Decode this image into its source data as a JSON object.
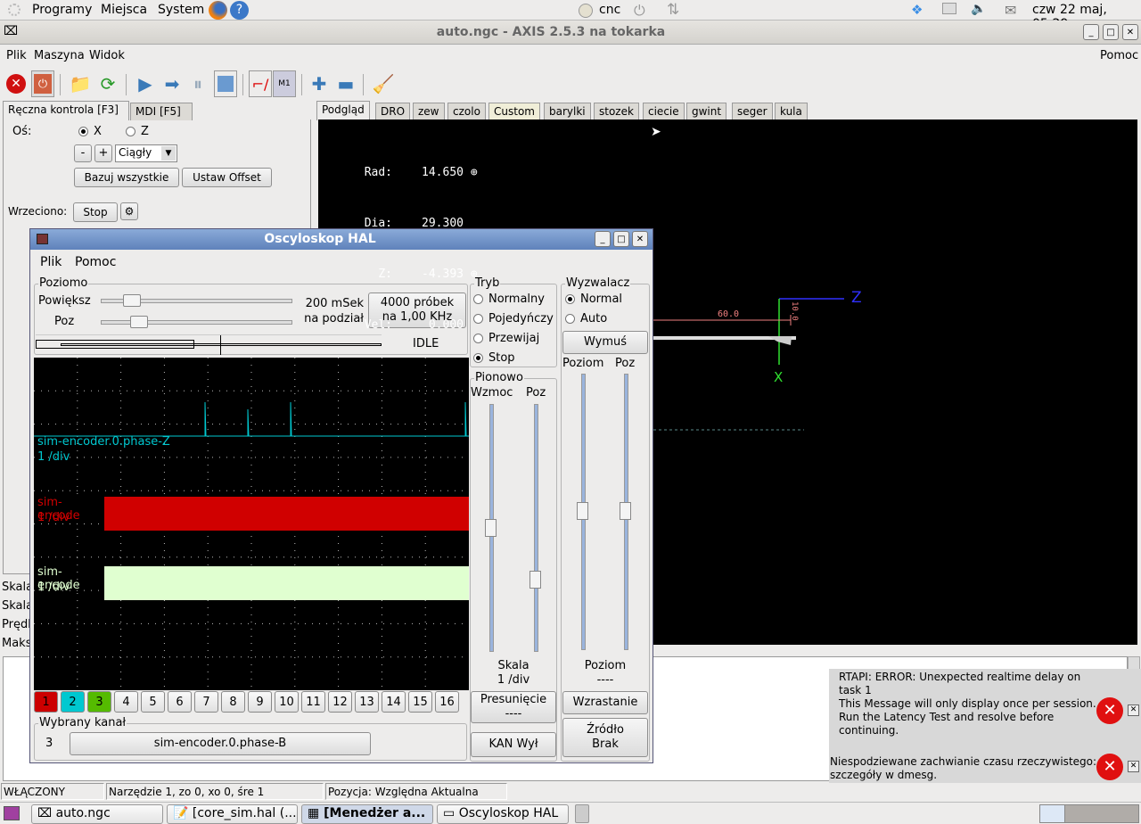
{
  "top_panel": {
    "menus": [
      "Programy",
      "Miejsca",
      "System"
    ],
    "user": "cnc",
    "clock": "czw 22 maj, 05:29"
  },
  "axis": {
    "title": "auto.ngc - AXIS 2.5.3 na tokarka",
    "menu": [
      "Plik",
      "Maszyna",
      "Widok"
    ],
    "help": "Pomoc",
    "left_tabs": [
      "Ręczna kontrola [F3]",
      "MDI [F5]"
    ],
    "manual": {
      "axis_label": "Oś:",
      "axis_x": "X",
      "axis_z": "Z",
      "minus": "-",
      "plus": "+",
      "jog_mode": "Ciągły",
      "home_all": "Bazuj wszystkie",
      "set_offset": "Ustaw Offset",
      "spindle_label": "Wrzeciono:",
      "spindle_stop": "Stop"
    },
    "side_labels": [
      "Skala",
      "Skala",
      "Prędk",
      "Maks"
    ],
    "right_tabs": [
      "Podgląd",
      "DRO",
      "zew",
      "czolo",
      "Custom",
      "barylki",
      "stozek",
      "ciecie",
      "gwint",
      "seger",
      "kula"
    ],
    "dro": [
      {
        "label": "Rad:",
        "value": "14.650"
      },
      {
        "label": "Dia:",
        "value": "29.300"
      },
      {
        "label": "Z:",
        "value": "-4.393"
      },
      {
        "label": "Vel:",
        "value": "0.000"
      }
    ],
    "preview": {
      "dim_z": "60.0",
      "dim_x": "10.0",
      "axis_z": "Z",
      "axis_x": "X"
    },
    "status": {
      "state": "WŁĄCZONY",
      "tool": "Narzędzie 1, zo 0, xo 0, śre 1",
      "position": "Pozycja: Względna Aktualna"
    },
    "notifications": [
      {
        "text": "RTAPI: ERROR: Unexpected realtime delay on task 1\nThis Message will only display once per session.\nRun the Latency Test and resolve before continuing."
      },
      {
        "text": "Niespodziewane zachwianie czasu rzeczywistego: szczegóły w dmesg."
      }
    ]
  },
  "scope": {
    "title": "Oscyloskop HAL",
    "menu": [
      "Plik",
      "Pomoc"
    ],
    "horizontal": {
      "legend": "Poziomo",
      "zoom_label": "Powiększ",
      "pos_label": "Poz",
      "rate": "200 mSek\nna podział",
      "samples": "4000 próbek\nna 1,00 KHz",
      "state": "IDLE"
    },
    "mode": {
      "legend": "Tryb",
      "options": [
        "Normalny",
        "Pojedyńczy",
        "Przewijaj",
        "Stop"
      ],
      "selected": "Stop"
    },
    "trigger": {
      "legend": "Wyzwalacz",
      "options": [
        "Normal",
        "Auto"
      ],
      "selected": "Normal",
      "force": "Wymuś",
      "level_label": "Poziom",
      "pos_label": "Poz",
      "level_title": "Poziom",
      "level_value": "----",
      "edge": "Wzrastanie",
      "source": "Źródło\nBrak"
    },
    "vertical": {
      "legend": "Pionowo",
      "gain_label": "Wzmoc",
      "pos_label": "Poz",
      "scale": "Skala\n1 /div",
      "offset": "Presunięcie\n----",
      "chan_off": "KAN Wył"
    },
    "traces": [
      {
        "name": "sim-encoder.0.phase-Z",
        "scale": "1 /div",
        "color": "#00c8d0"
      },
      {
        "name": "sim-encode",
        "scale": "1 /div",
        "color": "#d00000"
      },
      {
        "name": "sim-encode",
        "scale": "1 /div",
        "color": "#e0ffd0"
      }
    ],
    "channels": [
      "1",
      "2",
      "3",
      "4",
      "5",
      "6",
      "7",
      "8",
      "9",
      "10",
      "11",
      "12",
      "13",
      "14",
      "15",
      "16"
    ],
    "channel_colors": {
      "1": "#cc0000",
      "2": "#00c8d0",
      "3": "#55bb00"
    },
    "selected": {
      "legend": "Wybrany kanał",
      "number": "3",
      "name": "sim-encoder.0.phase-B"
    }
  },
  "taskbar": [
    "auto.ngc",
    "[core_sim.hal (...",
    "[Menedżer a...",
    "Oscyloskop HAL"
  ]
}
